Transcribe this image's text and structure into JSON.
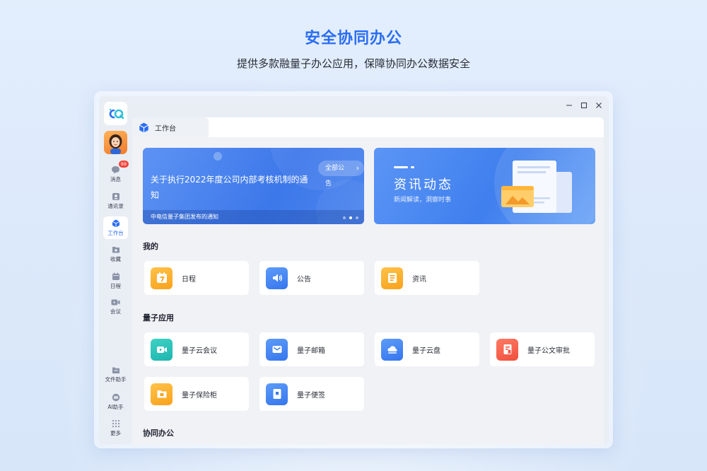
{
  "hero": {
    "title": "安全协同办公",
    "subtitle": "提供多款融量子办公应用，保障协同办公数据安全"
  },
  "sidebar": {
    "items": [
      {
        "label": "消息",
        "icon": "chat-icon",
        "badge": "99"
      },
      {
        "label": "通讯录",
        "icon": "contacts-icon"
      },
      {
        "label": "工作台",
        "icon": "workbench-icon",
        "active": true
      },
      {
        "label": "收藏",
        "icon": "star-icon"
      },
      {
        "label": "日程",
        "icon": "calendar-icon"
      },
      {
        "label": "会议",
        "icon": "video-icon"
      }
    ],
    "bottom_items": [
      {
        "label": "文件助手",
        "icon": "folder-icon"
      },
      {
        "label": "AI助手",
        "icon": "ai-icon"
      },
      {
        "label": "更多",
        "icon": "grid-icon"
      }
    ]
  },
  "tab": {
    "label": "工作台"
  },
  "banner_announcement": {
    "title": "关于执行2022年度公司内部考核机制的通知",
    "button": "全部公告",
    "footer": "中电信量子集团发布的通知"
  },
  "banner_news": {
    "title": "资讯动态",
    "subtitle": "新闻解读，洞察时事"
  },
  "sections": {
    "mine": {
      "title": "我的",
      "items": [
        {
          "label": "日程",
          "icon": "calendar-7-icon"
        },
        {
          "label": "公告",
          "icon": "speaker-icon"
        },
        {
          "label": "资讯",
          "icon": "news-icon"
        }
      ]
    },
    "quantum": {
      "title": "量子应用",
      "items": [
        {
          "label": "量子云会议",
          "icon": "video-meeting-icon"
        },
        {
          "label": "量子邮箱",
          "icon": "mail-icon"
        },
        {
          "label": "量子云盘",
          "icon": "cloud-drive-icon"
        },
        {
          "label": "量子公文审批",
          "icon": "document-approval-icon"
        },
        {
          "label": "量子保险柜",
          "icon": "safe-box-icon"
        },
        {
          "label": "量子便签",
          "icon": "sticky-note-icon"
        }
      ]
    },
    "collab": {
      "title": "协同办公"
    }
  },
  "colors": {
    "accent": "#2a6df4",
    "badge": "#f2433a",
    "orange": "#f9a21a",
    "teal": "#1db5b0",
    "red": "#f0503d"
  }
}
